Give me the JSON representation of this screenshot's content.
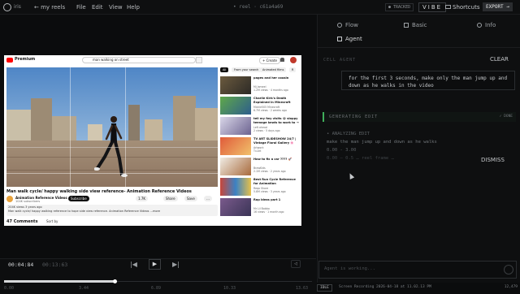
{
  "topbar": {
    "brand": "iris",
    "breadcrumb": "← my reels",
    "menu": [
      "File",
      "Edit",
      "View",
      "Help"
    ],
    "reel_id": "• reel · c61a4a69",
    "tracked": "● TRACKED",
    "mode": "VIBE",
    "shortcuts": "Shortcuts",
    "export": "EXPORT →"
  },
  "youtube": {
    "logo_text": "Premium",
    "search_query": "man walking on street",
    "create": "+ Create",
    "title": "Man walk cycle/ happy walking side view reference- Animation Reference Videos",
    "channel": "Animation Reference Videos",
    "subs": "104K subscribers",
    "subscribe": "Subscribe",
    "actions": [
      "1.7K",
      "Share",
      "Save",
      "…"
    ],
    "description": "204K views 3 years ago\nMan walk cycle/ happy walking reference to hope side view reference. Animation Reference Videos ...more",
    "comments": "47 Comments",
    "sort": "Sort by",
    "chips": [
      "All",
      "From your search",
      "Animated films",
      "R"
    ],
    "recommended": [
      {
        "title": "pages and her cousin",
        "sub": "Mj Jameel\n1.2M views · 4 months ago"
      },
      {
        "title": "Charlie Kirk's Death Explained in Minecraft",
        "sub": "Mickle505 Minecraft\n6.7M views · 2 weeks ago"
      },
      {
        "title": "tell my fwy visits 😭 sloppy teenage kewls to work to →",
        "sub": "Left ahead\n2 views · 5 days ago"
      },
      {
        "title": "TV ART SLIDESHOW 24/7 | Vintage Floral Gallery 🌸",
        "sub": "Artwork\nTv.Art"
      },
      {
        "title": "How to fix a car ???? 🚀",
        "sub": "BrawKids\n2.1M views · 2 years ago"
      },
      {
        "title": "Best Run Cycle Reference for Animation",
        "sub": "Reqo Shore\n5.8M views · 3 years ago"
      },
      {
        "title": "Rap ideas part 1",
        "sub": "Mr Lil Bobbo\n16 views · 1 month ago"
      }
    ]
  },
  "transport": {
    "current": "00:04:84",
    "total": "00:13:63",
    "volume": "◁",
    "ticks": [
      "0.00",
      "3.44",
      "6.89",
      "10.33",
      "13.63"
    ],
    "progress": 0.36
  },
  "panel": {
    "tabs": [
      "Flow",
      "Basic",
      "Info",
      "Agent"
    ],
    "section_label": "CELL AGENT",
    "clear": "CLEAR",
    "prompt": "for the first 3 seconds, make only the man jump up and down as he walks in the video",
    "generating": "GENERATING EDIT",
    "done": "✓ DONE",
    "result_title": "• ANALYZING EDIT",
    "result_lines": [
      "make the man jump up and down as he walks",
      "0.00 - 3.00"
    ],
    "result_extra": "0.00 — 0.5 … reel frame …",
    "dismiss": "DISMISS",
    "input_placeholder": "Agent is working...",
    "status_badge": "IDLE",
    "status_text": "Screen Recording 2026-04-18 at 11.02.13 PM",
    "status_count": "12,479"
  },
  "colors": {
    "accent_green": "#3fae5a",
    "youtube_red": "#ff0000",
    "background": "#0b0c0d"
  }
}
